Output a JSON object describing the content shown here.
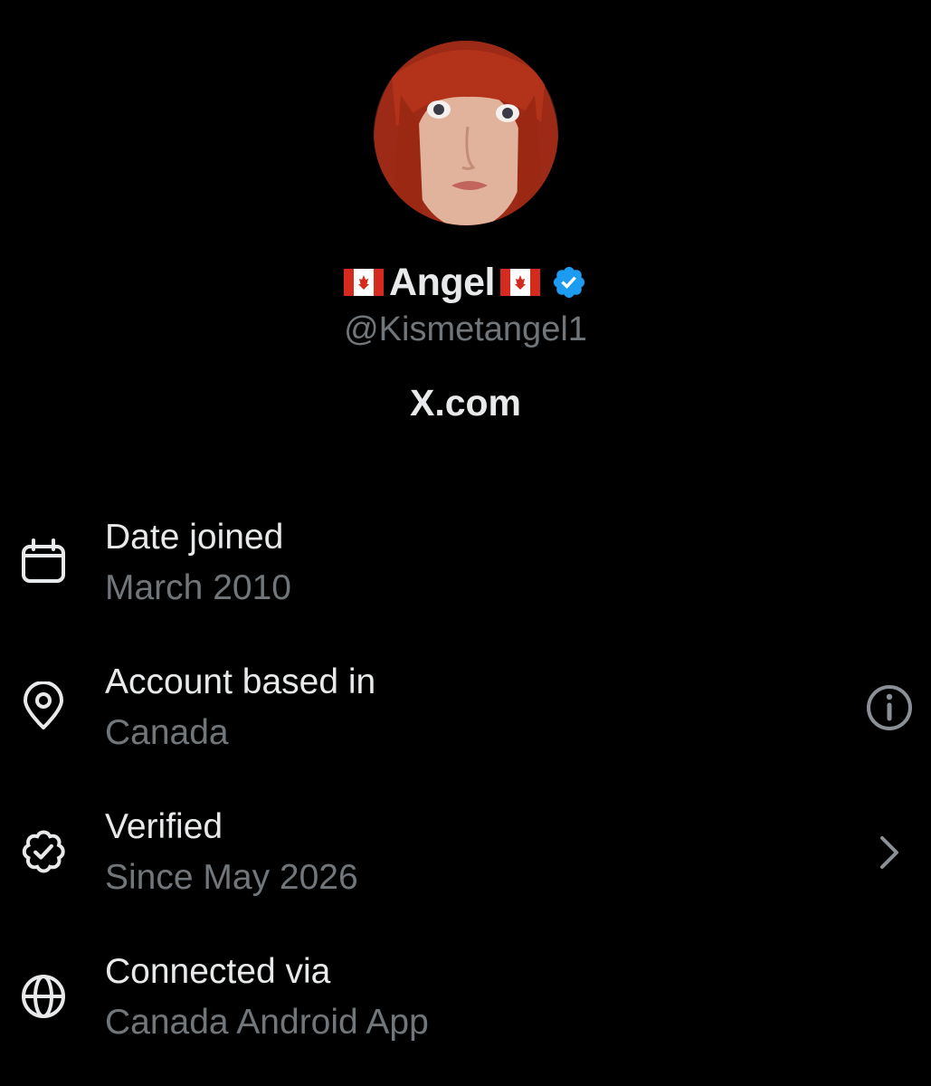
{
  "profile": {
    "display_name": "Angel",
    "handle": "@Kismetangel1",
    "site": "X.com",
    "name_flag_icon": "canada-flag-emoji",
    "verified_icon": "verified-badge-icon",
    "verified_color": "#1d9bf0"
  },
  "about": {
    "rows": [
      {
        "title": "Date joined",
        "value": "March 2010",
        "icon": "calendar-icon"
      },
      {
        "title": "Account based in",
        "value": "Canada",
        "icon": "location-pin-icon",
        "action_icon": "info-icon"
      },
      {
        "title": "Verified",
        "value": "Since May 2026",
        "icon": "verified-outline-icon",
        "action_icon": "chevron-right-icon"
      },
      {
        "title": "Connected via",
        "value": "Canada Android App",
        "icon": "globe-icon"
      }
    ]
  },
  "colors": {
    "background": "#000000",
    "primary_text": "#e7e9ea",
    "secondary_text": "#71767b"
  }
}
